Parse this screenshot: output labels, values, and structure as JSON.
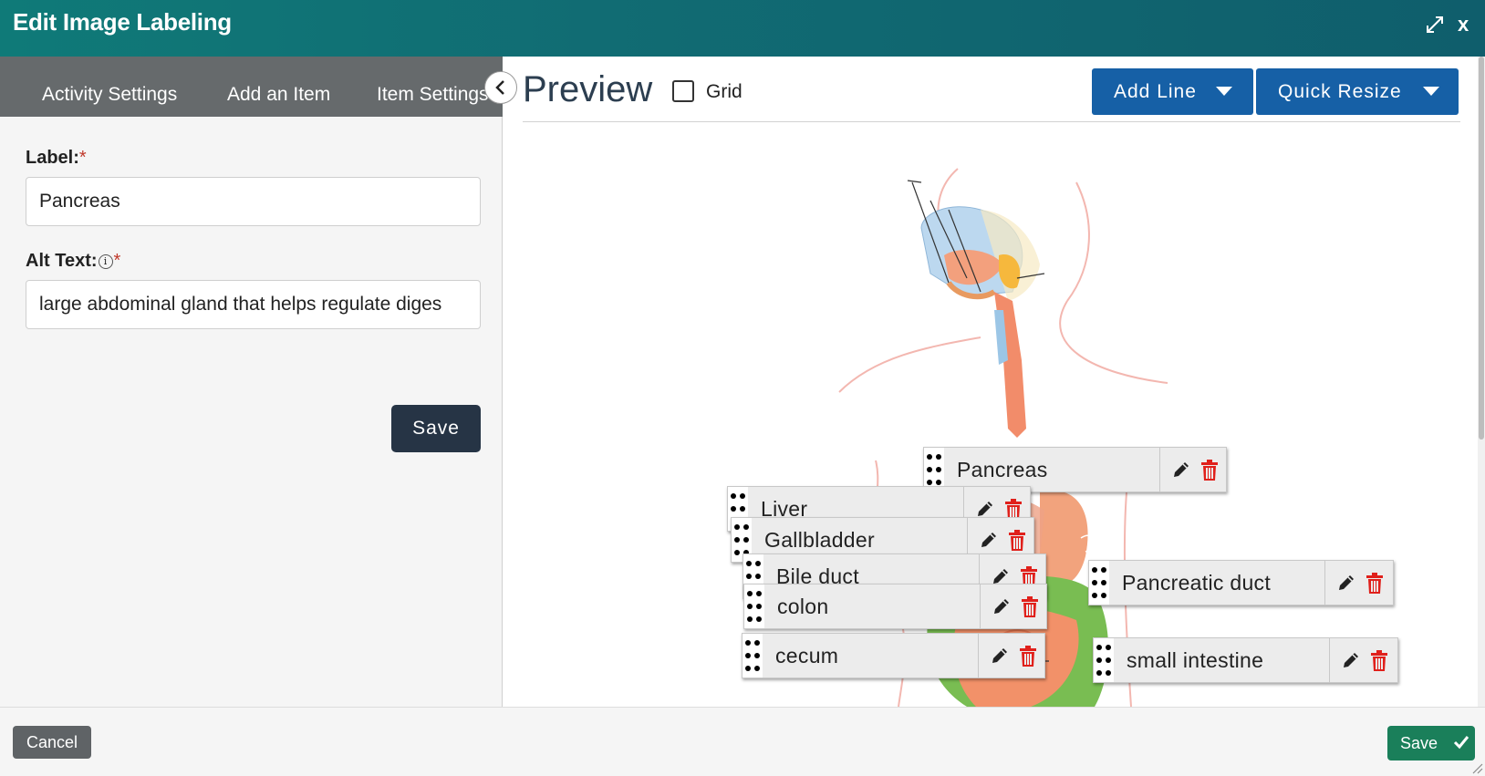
{
  "dialog": {
    "title": "Edit Image Labeling",
    "close_label": "x"
  },
  "tabs": [
    {
      "label": "Activity Settings"
    },
    {
      "label": "Add an Item"
    },
    {
      "label": "Item Settings"
    }
  ],
  "form": {
    "label_field": {
      "label": "Label:",
      "required_mark": "*",
      "value": "Pancreas"
    },
    "alt_text_field": {
      "label": "Alt Text:",
      "info_glyph": "i",
      "required_mark": "*",
      "value": "large abdominal gland that helps regulate diges"
    },
    "save_label": "Save"
  },
  "preview": {
    "title": "Preview",
    "grid_label": "Grid",
    "grid_checked": false,
    "add_line_label": "Add Line",
    "quick_resize_label": "Quick Resize"
  },
  "labels": [
    {
      "text": "Pancreas"
    },
    {
      "text": "Liver"
    },
    {
      "text": "Gallbladder"
    },
    {
      "text": "Bile duct"
    },
    {
      "text": "colon"
    },
    {
      "text": "cecum"
    },
    {
      "text": "Pancreatic duct"
    },
    {
      "text": "small intestine"
    }
  ],
  "footer": {
    "cancel_label": "Cancel",
    "save_label": "Save"
  },
  "colors": {
    "header": "#116c73",
    "primary_blue": "#1660a6",
    "dark_button": "#263445",
    "success_green": "#1a7f5a",
    "delete_red": "#e0201b"
  },
  "icons": [
    "expand-icon",
    "close-icon",
    "chevron-left-icon",
    "info-icon",
    "caret-down-icon",
    "drag-handle-icon",
    "pencil-icon",
    "trash-icon",
    "check-icon",
    "resize-grip-icon"
  ]
}
